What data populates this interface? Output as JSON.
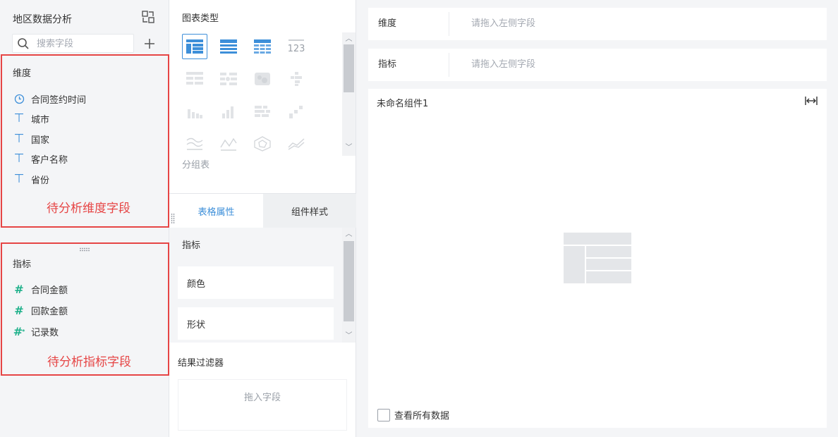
{
  "left": {
    "title": "地区数据分析",
    "search_placeholder": "搜索字段",
    "dimension": {
      "title": "维度",
      "fields": [
        {
          "label": "合同签约时间",
          "icon": "clock-icon"
        },
        {
          "label": "城市",
          "icon": "text-type-icon"
        },
        {
          "label": "国家",
          "icon": "text-type-icon"
        },
        {
          "label": "客户名称",
          "icon": "text-type-icon"
        },
        {
          "label": "省份",
          "icon": "text-type-icon"
        }
      ],
      "annotation": "待分析维度字段"
    },
    "metric": {
      "title": "指标",
      "fields": [
        {
          "label": "合同金额",
          "icon": "number-type-icon"
        },
        {
          "label": "回款金额",
          "icon": "number-type-icon"
        },
        {
          "label": "记录数",
          "icon": "count-type-icon"
        }
      ],
      "annotation": "待分析指标字段"
    }
  },
  "middle": {
    "chart_type_title": "图表类型",
    "selected_chart_label": "分组表",
    "tabs": [
      {
        "label": "表格属性",
        "active": true
      },
      {
        "label": "组件样式",
        "active": false
      }
    ],
    "props_title": "指标",
    "props": [
      {
        "label": "颜色"
      },
      {
        "label": "形状"
      }
    ],
    "filter_title": "结果过滤器",
    "filter_placeholder": "拖入字段"
  },
  "right": {
    "dimension_row": {
      "label": "维度",
      "placeholder": "请拖入左侧字段"
    },
    "metric_row": {
      "label": "指标",
      "placeholder": "请拖入左侧字段"
    },
    "component_title": "未命名组件1",
    "view_all_label": "查看所有数据"
  },
  "colors": {
    "accent": "#3d8fd9",
    "annotation_red": "#e64545",
    "metric_green": "#1fb18b"
  }
}
